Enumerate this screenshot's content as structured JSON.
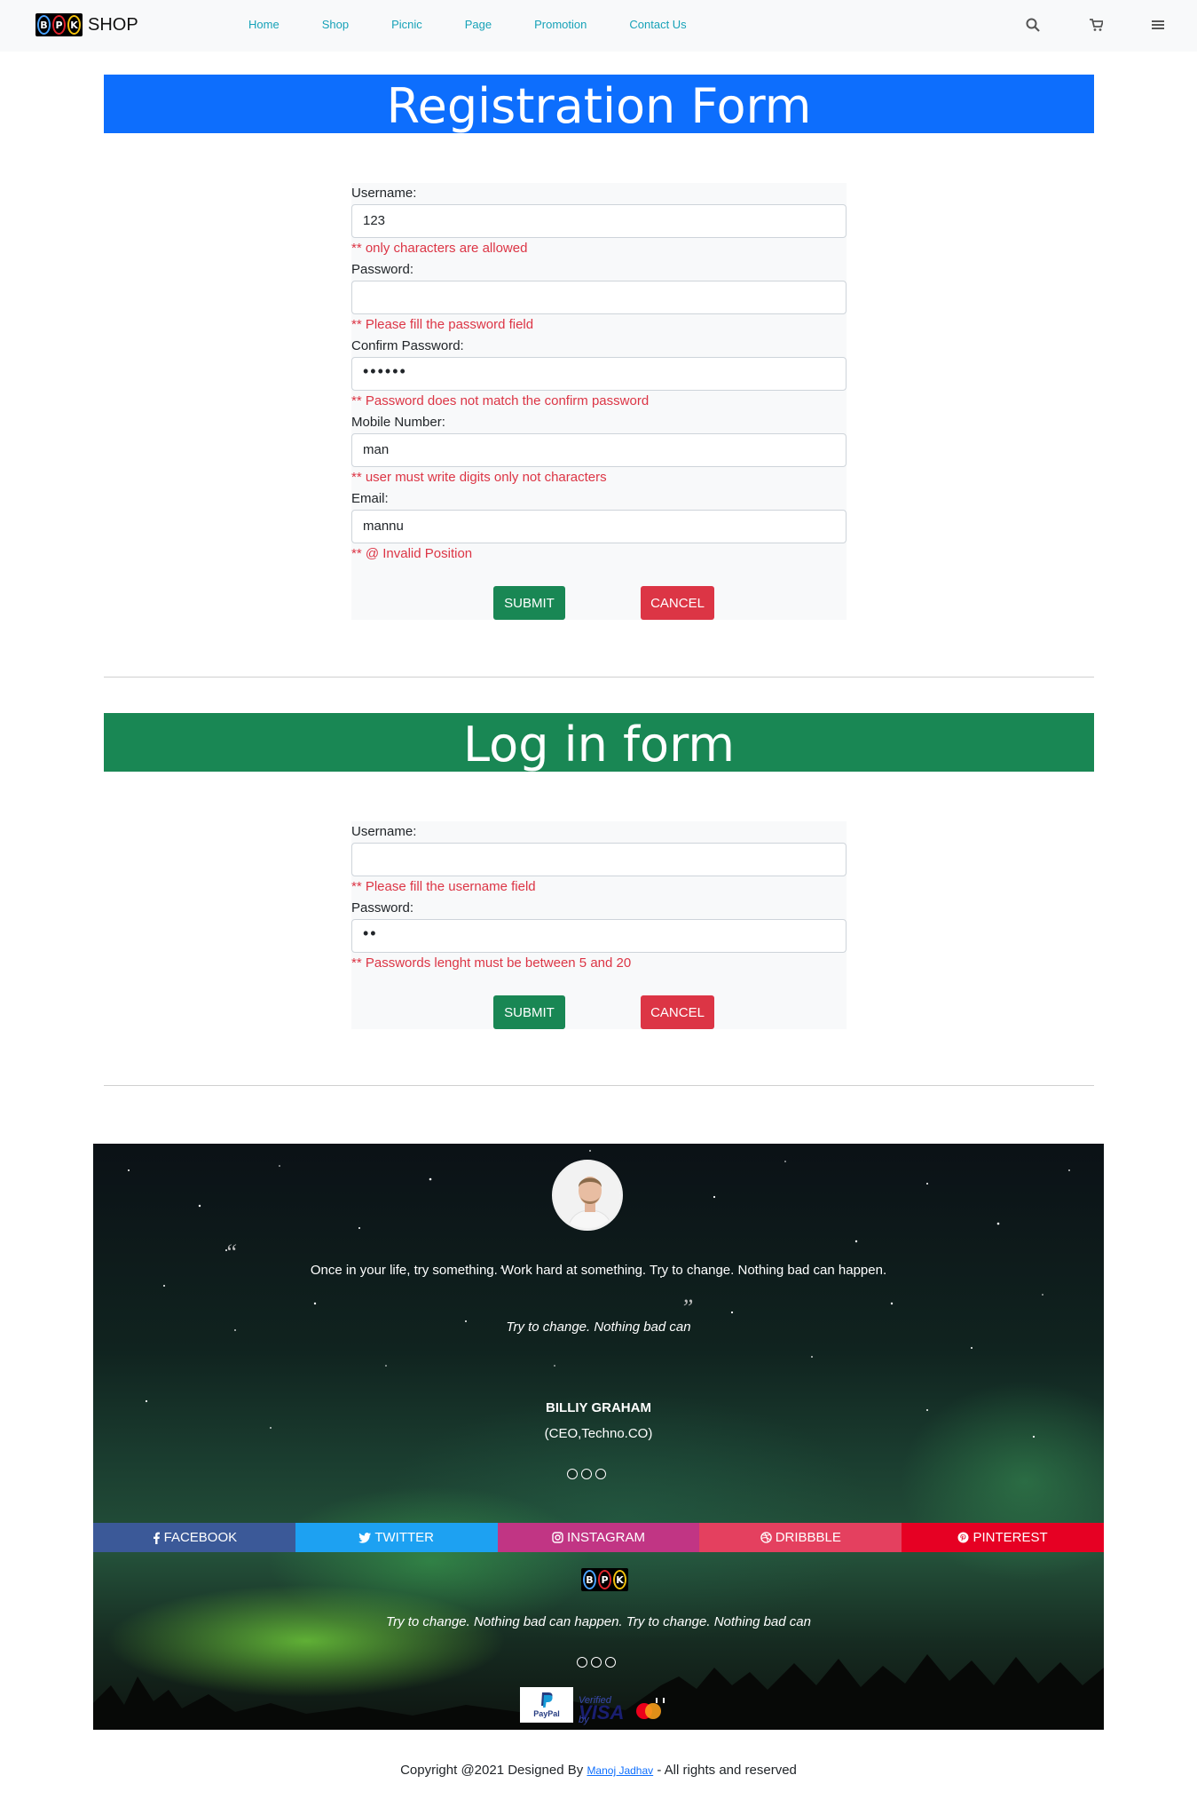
{
  "nav": {
    "brand_letters": [
      "B",
      "P",
      "K"
    ],
    "brand_text": "SHOP",
    "links": [
      "Home",
      "Shop",
      "Picnic",
      "Page",
      "Promotion",
      "Contact Us"
    ]
  },
  "registration": {
    "title": "Registration Form",
    "username_label": "Username:",
    "username_value": "123",
    "username_error": "** only characters are allowed",
    "password_label": "Password:",
    "password_value": "",
    "password_error": "** Please fill the password field",
    "confirm_label": "Confirm Password:",
    "confirm_value": "••••••",
    "confirm_error": "** Password does not match the confirm password",
    "mobile_label": "Mobile Number:",
    "mobile_value": "man",
    "mobile_error": "** user must write digits only not characters",
    "email_label": "Email:",
    "email_value": "mannu",
    "email_error": "** @ Invalid Position",
    "submit": "SUBMIT",
    "cancel": "CANCEL"
  },
  "login": {
    "title": "Log in form",
    "username_label": "Username:",
    "username_value": "",
    "username_error": "** Please fill the username field",
    "password_label": "Password:",
    "password_value": "••",
    "password_error": "** Passwords lenght must be between 5 and 20",
    "submit": "SUBMIT",
    "cancel": "CANCEL"
  },
  "testimonial": {
    "quote": "Once in your life, try something. Work hard at something. Try to change. Nothing bad can happen.",
    "sub_quote": "Try to change. Nothing bad can",
    "name": "BILLIY GRAHAM",
    "role": "(CEO,Techno.CO)"
  },
  "social": [
    "FACEBOOK",
    "TWITTER",
    "INSTAGRAM",
    "DRIBBBLE",
    "PINTEREST"
  ],
  "footer": {
    "tagline": "Try to change. Nothing bad can happen. Try to change. Nothing bad can",
    "paypal": "PayPal",
    "visa_small": "Verified by",
    "visa": "VISA"
  },
  "copyright": {
    "before": "Copyright @2021 Designed By ",
    "author": "Manoj Jadhav",
    "after": " - All rights and reserved"
  }
}
